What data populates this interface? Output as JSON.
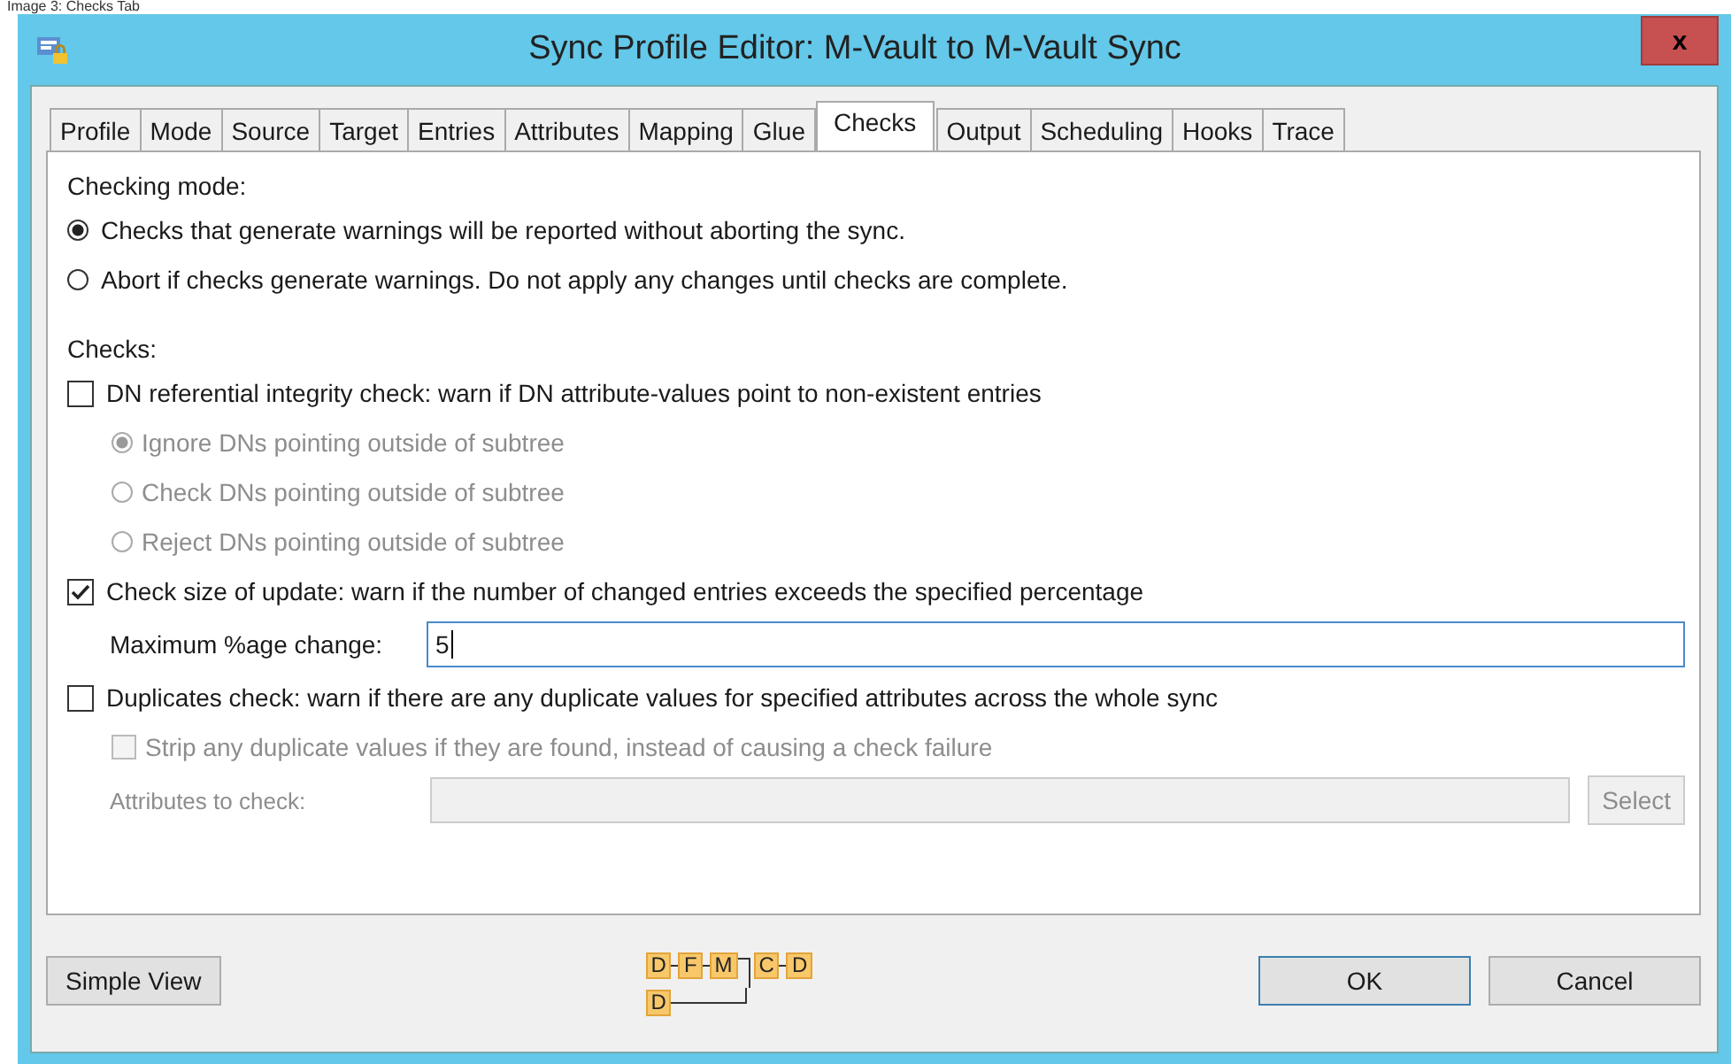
{
  "caption": "Image 3: Checks Tab",
  "window": {
    "title": "Sync Profile Editor: M-Vault to M-Vault Sync",
    "close": "x"
  },
  "tabs": [
    {
      "label": "Profile",
      "selected": false
    },
    {
      "label": "Mode",
      "selected": false
    },
    {
      "label": "Source",
      "selected": false
    },
    {
      "label": "Target",
      "selected": false
    },
    {
      "label": "Entries",
      "selected": false
    },
    {
      "label": "Attributes",
      "selected": false
    },
    {
      "label": "Mapping",
      "selected": false
    },
    {
      "label": "Glue",
      "selected": false
    },
    {
      "label": "Checks",
      "selected": true
    },
    {
      "label": "Output",
      "selected": false
    },
    {
      "label": "Scheduling",
      "selected": false
    },
    {
      "label": "Hooks",
      "selected": false
    },
    {
      "label": "Trace",
      "selected": false
    }
  ],
  "checking_mode": {
    "label": "Checking mode:",
    "options": [
      {
        "label": "Checks that generate warnings will be reported without aborting the sync.",
        "selected": true,
        "disabled": false
      },
      {
        "label": "Abort if checks generate warnings.  Do not apply any changes until checks are complete.",
        "selected": false,
        "disabled": false
      }
    ]
  },
  "checks": {
    "label": "Checks:",
    "items": [
      {
        "label": "DN referential integrity check: warn if DN attribute-values point to non-existent entries",
        "checked": false,
        "options": [
          {
            "label": "Ignore DNs pointing outside of subtree",
            "selected": true,
            "disabled": true
          },
          {
            "label": "Check DNs pointing outside of subtree",
            "selected": false,
            "disabled": true
          },
          {
            "label": "Reject DNs pointing outside of subtree",
            "selected": false,
            "disabled": true
          }
        ]
      },
      {
        "label": "Check size of update: warn if the number of changed entries exceeds the specified percentage",
        "checked": true,
        "fields": [
          {
            "label": "Maximum %age change:",
            "value": "5",
            "disabled": false
          }
        ]
      },
      {
        "label": "Duplicates check: warn if there are any duplicate values for specified attributes across the whole sync",
        "checked": false,
        "sub_checks": [
          {
            "label": "Strip any duplicate values if they are found, instead of causing a check failure",
            "checked": false,
            "disabled": true
          }
        ],
        "fields": [
          {
            "label": "Attributes to check:",
            "disabled": true,
            "button": {
              "label": "Select",
              "disabled": true
            }
          }
        ]
      }
    ]
  },
  "footer": {
    "left_button": "Simple View",
    "flow": {
      "top": [
        "D",
        "F",
        "M"
      ],
      "bottom": [
        "D"
      ],
      "out": [
        "C",
        "D"
      ]
    },
    "buttons": [
      "OK",
      "Cancel"
    ]
  }
}
